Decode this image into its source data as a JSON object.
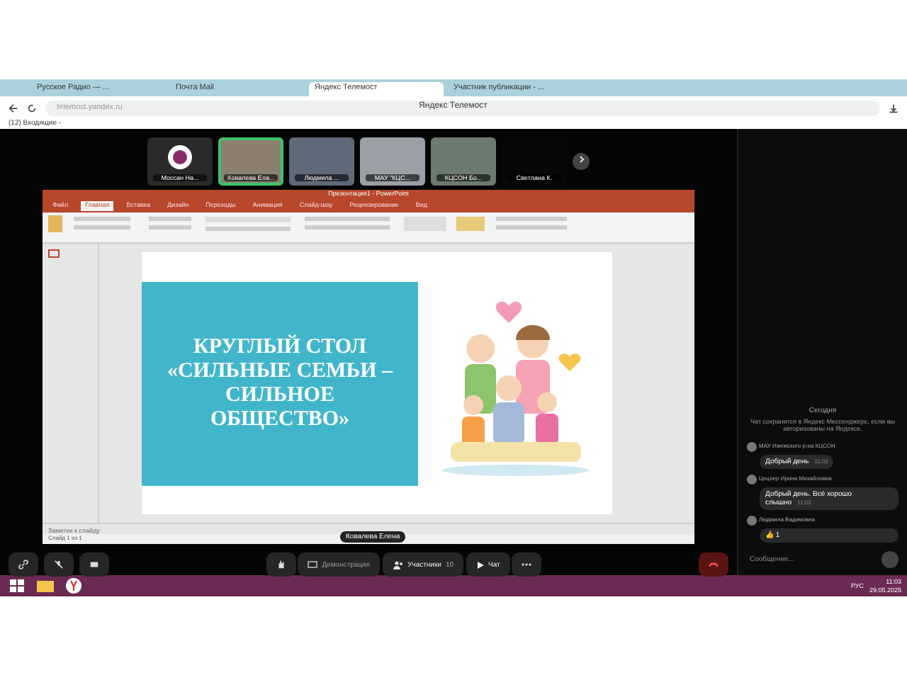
{
  "browser": {
    "tabs": [
      {
        "label": "Русское Радио — ...",
        "selected": false
      },
      {
        "label": "Почта Mail",
        "selected": false
      },
      {
        "label": "Яндекс Телемост",
        "selected": true
      },
      {
        "label": "Участник публикации - ...",
        "selected": false
      }
    ],
    "address": "telemost.yandex.ru",
    "page_title": "Яндекс Телемост",
    "bookmark": "(12) Входящие -"
  },
  "participants": [
    {
      "name": "Моссан На...",
      "kind": "logo",
      "speaking": false
    },
    {
      "name": "Ховалева Ела...",
      "kind": "video",
      "speaking": true
    },
    {
      "name": "Людмила ...",
      "kind": "video",
      "speaking": false
    },
    {
      "name": "МАУ \"КЦС...",
      "kind": "video",
      "speaking": false
    },
    {
      "name": "КЦСОН Бо...",
      "kind": "video",
      "speaking": false
    },
    {
      "name": "Светлана К.",
      "kind": "empty",
      "speaking": false
    }
  ],
  "presentation": {
    "window_title": "Презентация1 - PowerPoint",
    "ribbon_tabs": [
      {
        "label": "Файл",
        "selected": false
      },
      {
        "label": "Главная",
        "selected": true
      },
      {
        "label": "Вставка",
        "selected": false
      },
      {
        "label": "Дизайн",
        "selected": false
      },
      {
        "label": "Переходы",
        "selected": false
      },
      {
        "label": "Анимация",
        "selected": false
      },
      {
        "label": "Слайд-шоу",
        "selected": false
      },
      {
        "label": "Рецензирование",
        "selected": false
      },
      {
        "label": "Вид",
        "selected": false
      }
    ],
    "slide_title": "КРУГЛЫЙ СТОЛ «СИЛЬНЫЕ СЕМЬИ – СИЛЬНОЕ ОБЩЕСТВО»",
    "notes": "Заметки к слайду",
    "status": "Слайд 1 из 1",
    "presenter": "Ковалева Елена"
  },
  "controls": {
    "share": {
      "label": "Демонстрация",
      "disabled": true
    },
    "participants": {
      "label": "Участники",
      "count": "10"
    },
    "chat": "Чат"
  },
  "chat": {
    "date": "Сегодня",
    "notice": "Чат сохранится в Яндекс Мессенджере, если вы авторизованы на Яндексе.",
    "messages": [
      {
        "kind": "text",
        "author": "МАУ Ижемского р-на КЦСОН",
        "text": "Добрый день",
        "time": "11:02"
      },
      {
        "kind": "text",
        "author": "Цецлер Ирина Михайловна",
        "text": "Добрый день. Всё хорошо слышно",
        "time": "11:02"
      },
      {
        "kind": "reaction",
        "author": "Людмила Вадимовна",
        "text": "👍 1"
      }
    ],
    "placeholder": "Сообщение..."
  },
  "taskbar": {
    "language": "РУС",
    "time": "11:03",
    "date": "29.05.2025"
  }
}
